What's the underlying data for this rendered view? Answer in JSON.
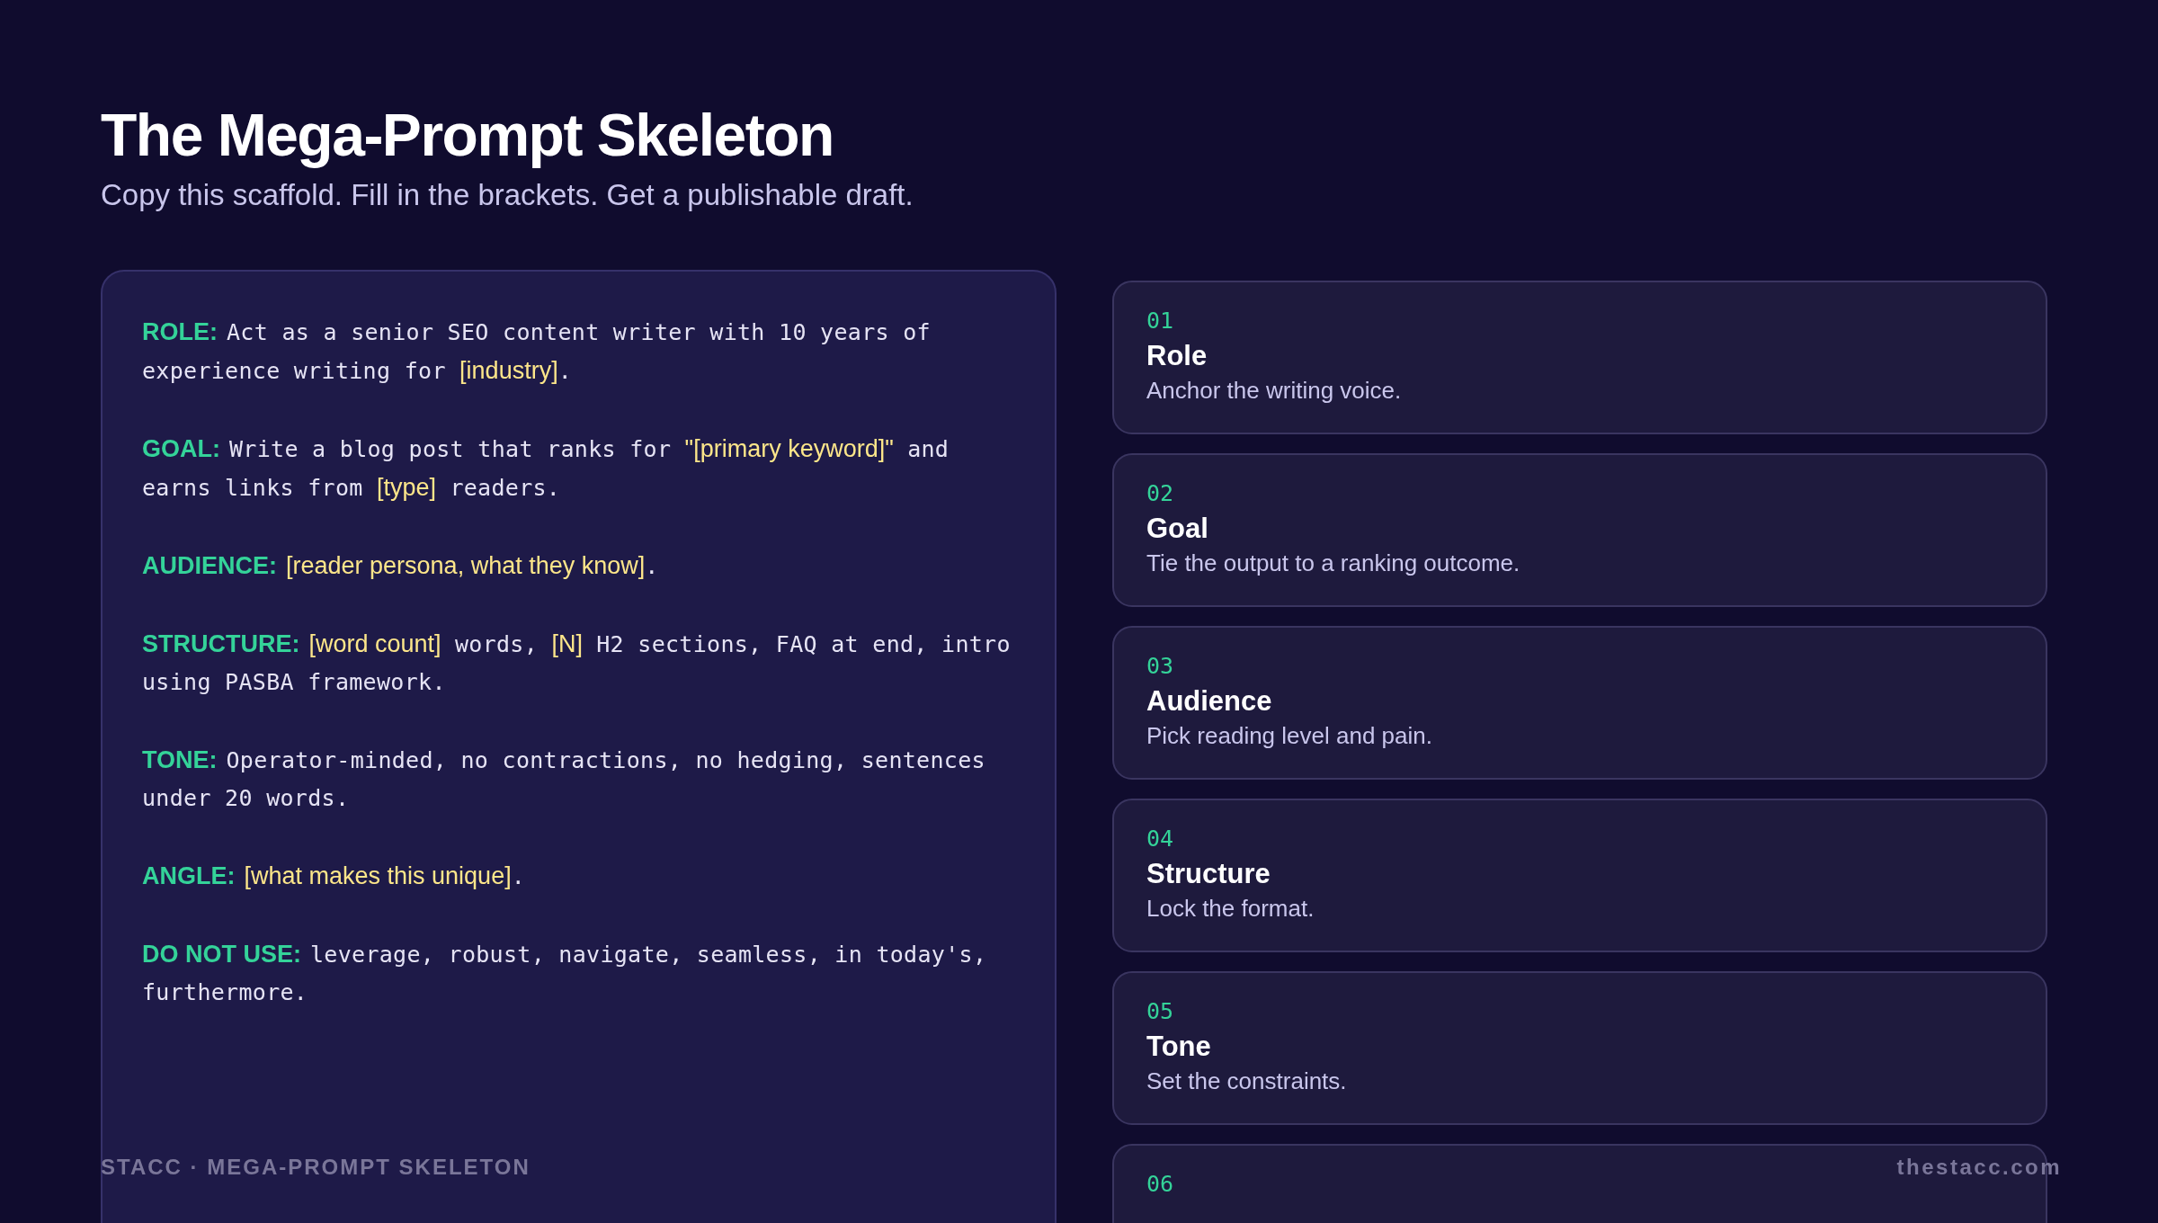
{
  "header": {
    "title": "The Mega-Prompt Skeleton",
    "subtitle": "Copy this scaffold. Fill in the brackets. Get a publishable draft."
  },
  "prompt_sections": [
    {
      "label": "ROLE:",
      "parts": [
        {
          "kind": "text",
          "text": "Act as a senior SEO content writer with 10 years of experience writing for "
        },
        {
          "kind": "placeholder",
          "text": "[industry]"
        },
        {
          "kind": "text",
          "text": "."
        }
      ]
    },
    {
      "label": "GOAL:",
      "parts": [
        {
          "kind": "text",
          "text": "Write a blog post that ranks for "
        },
        {
          "kind": "placeholder",
          "text": "\"[primary keyword]\""
        },
        {
          "kind": "text",
          "text": " and earns links from "
        },
        {
          "kind": "placeholder",
          "text": "[type]"
        },
        {
          "kind": "text",
          "text": " readers."
        }
      ]
    },
    {
      "label": "AUDIENCE:",
      "parts": [
        {
          "kind": "placeholder",
          "text": "[reader persona, what they know]"
        },
        {
          "kind": "text",
          "text": "."
        }
      ]
    },
    {
      "label": "STRUCTURE:",
      "parts": [
        {
          "kind": "placeholder",
          "text": "[word count]"
        },
        {
          "kind": "text",
          "text": " words, "
        },
        {
          "kind": "placeholder",
          "text": "[N]"
        },
        {
          "kind": "text",
          "text": " H2 sections, FAQ at end, intro using PASBA framework."
        }
      ]
    },
    {
      "label": "TONE:",
      "parts": [
        {
          "kind": "text",
          "text": "Operator-minded, no contractions, no hedging, sentences under 20 words."
        }
      ]
    },
    {
      "label": "ANGLE:",
      "parts": [
        {
          "kind": "placeholder",
          "text": "[what makes this unique]"
        },
        {
          "kind": "text",
          "text": "."
        }
      ]
    },
    {
      "label": "DO NOT USE:",
      "parts": [
        {
          "kind": "text",
          "text": "leverage, robust, navigate, seamless, in today's, furthermore."
        }
      ]
    }
  ],
  "steps": [
    {
      "number": "01",
      "title": "Role",
      "description": "Anchor the writing voice."
    },
    {
      "number": "02",
      "title": "Goal",
      "description": "Tie the output to a ranking outcome."
    },
    {
      "number": "03",
      "title": "Audience",
      "description": "Pick reading level and pain."
    },
    {
      "number": "04",
      "title": "Structure",
      "description": "Lock the format."
    },
    {
      "number": "05",
      "title": "Tone",
      "description": "Set the constraints."
    },
    {
      "number": "06"
    }
  ],
  "footer": {
    "left": "STACC · MEGA-PROMPT SKELETON",
    "right": "thestacc.com"
  }
}
